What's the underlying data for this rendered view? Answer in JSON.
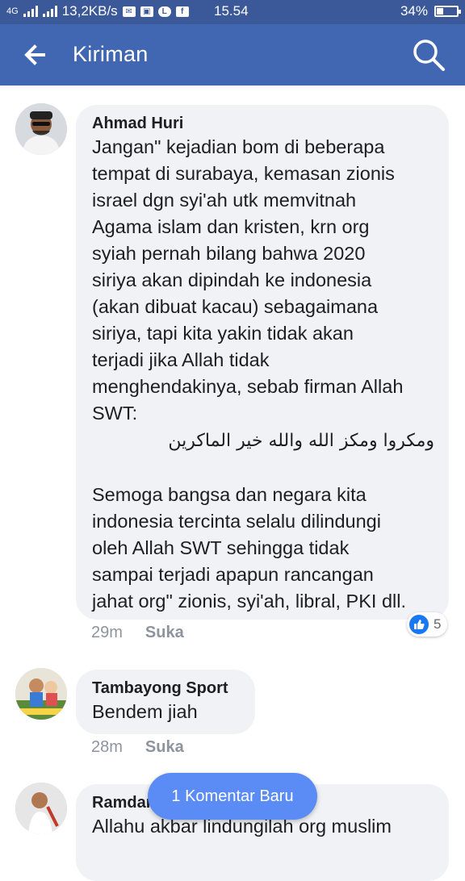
{
  "status_bar": {
    "network": "4G",
    "speed": "13,2KB/s",
    "time": "15.54",
    "battery": "34%",
    "battery_level": 0.34
  },
  "header": {
    "title": "Kiriman",
    "back_icon": "arrow-left-icon",
    "search_icon": "search-icon"
  },
  "comments": [
    {
      "author": "Ahmad Huri",
      "lines": [
        "Jangan\" kejadian bom di beberapa",
        "tempat di surabaya, kemasan zionis",
        "israel dgn syi'ah utk memvitnah",
        "Agama islam dan kristen, krn org",
        "syiah pernah bilang bahwa 2020",
        "siriya akan dipindah ke indonesia",
        "(akan dibuat kacau) sebagaimana",
        "siriya, tapi kita yakin tidak akan",
        "terjadi jika Allah tidak",
        "menghendakinya, sebab firman Allah",
        "SWT:"
      ],
      "arabic": "ومكروا ومكز الله والله خير الماكرين",
      "lines2": [
        "Semoga bangsa dan negara kita",
        "indonesia tercinta selalu dilindungi",
        "oleh Allah SWT sehingga tidak",
        "sampai terjadi apapun rancangan",
        "jahat org\" zionis, syi'ah, libral, PKI dll."
      ],
      "time": "29m",
      "like_label": "Suka",
      "reaction_count": "5"
    },
    {
      "author": "Tambayong Sport",
      "text": "Bendem jiah",
      "time": "28m",
      "like_label": "Suka"
    },
    {
      "author": "Ramdan",
      "text": "Allahu akbar lindungilah org muslim"
    }
  ],
  "new_comment_button": "1 Komentar Baru",
  "colors": {
    "status_bar": "#3b5998",
    "app_bar": "#4267b2",
    "bubble": "#f0f2f5",
    "like_blue": "#1877f2",
    "new_comment": "#5b8bf4"
  }
}
